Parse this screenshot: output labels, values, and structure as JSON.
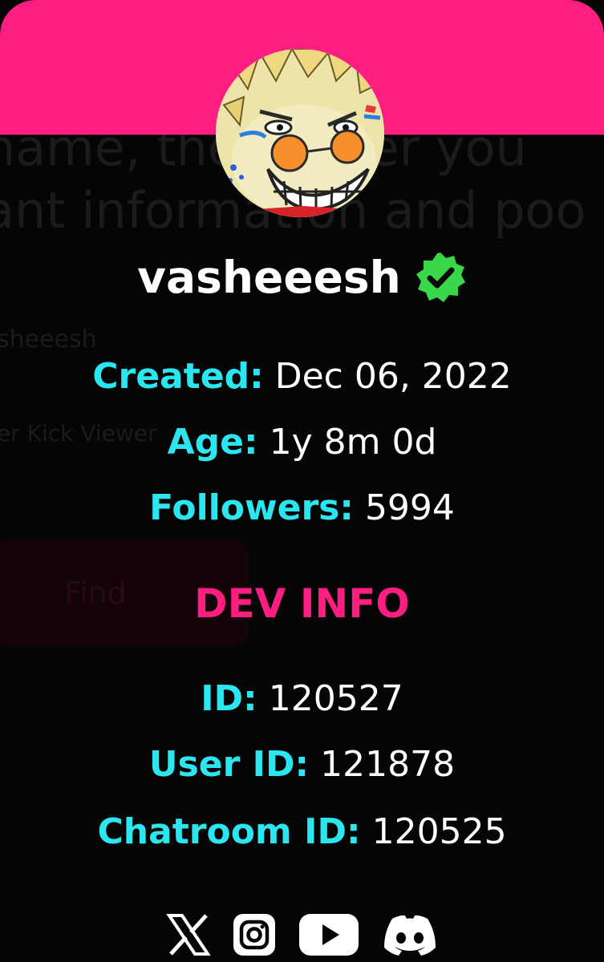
{
  "profile": {
    "username": "vasheeesh",
    "verified": true
  },
  "stats": {
    "created_label": "Created:",
    "created_value": "Dec 06, 2022",
    "age_label": "Age:",
    "age_value": "1y 8m 0d",
    "followers_label": "Followers:",
    "followers_value": "5994"
  },
  "dev_info": {
    "title": "DEV INFO",
    "id_label": "ID:",
    "id_value": "120527",
    "user_id_label": "User ID:",
    "user_id_value": "121878",
    "chatroom_id_label": "Chatroom ID:",
    "chatroom_id_value": "120525"
  },
  "background_page": {
    "line1": "name, the viewer you",
    "line2": "ant information and poo",
    "line3": "sheeesh",
    "line4": "er Kick Viewer",
    "button_label": "Find"
  },
  "socials": [
    {
      "icon": "x-icon"
    },
    {
      "icon": "instagram-icon"
    },
    {
      "icon": "youtube-icon"
    },
    {
      "icon": "discord-icon"
    }
  ],
  "colors": {
    "accent_pink": "#fe1d80",
    "label_cyan": "#2be5ef",
    "verified_green": "#39d84a",
    "background": "#050505"
  }
}
